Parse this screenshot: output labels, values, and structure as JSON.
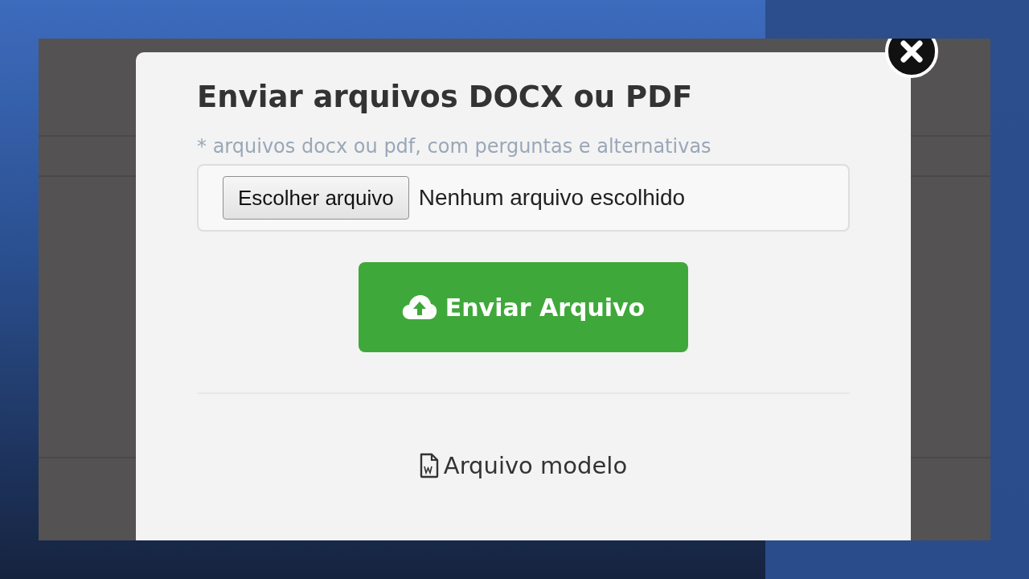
{
  "modal": {
    "title": "Enviar arquivos DOCX ou PDF",
    "hint": "* arquivos docx ou pdf, com perguntas e alternativas",
    "file_input": {
      "button": "Escolher arquivo",
      "status": "Nenhum arquivo escolhido"
    },
    "upload_button": "Enviar Arquivo",
    "template_link": "Arquivo modelo"
  }
}
